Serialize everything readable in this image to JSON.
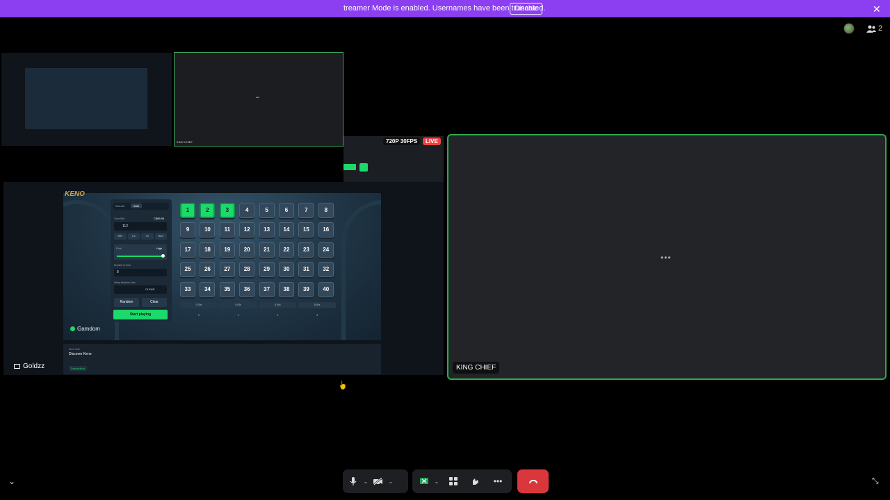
{
  "banner": {
    "text": "treamer Mode is enabled. Usernames have been truncated.",
    "disable_label": "Disable",
    "close_icon": "close-icon"
  },
  "top_right": {
    "people_count": "2"
  },
  "nested_share": {
    "title": "KING LIVES",
    "participant_name": "KING CHIEF"
  },
  "stream_badges": {
    "resolution": "720P 30FPS",
    "live": "LIVE"
  },
  "game": {
    "logo": "KENO",
    "tabs": [
      "Manual",
      "Auto"
    ],
    "your_bet_label": "Your Bet",
    "balance": "C$68.96",
    "bet_value": "112",
    "bet_chips": [
      "MIN",
      "1/2",
      "X2",
      "MAX"
    ],
    "risk_label": "Risk",
    "risk_value": "High",
    "number_of_games_label": "Number of bets",
    "number_of_games_value": "8",
    "delay_label": "Delay between bets",
    "delay_clear": "CLEAR",
    "random_label": "Random",
    "clear_label": "Clear",
    "start_label": "Start playing",
    "brand": "Gamdom",
    "numbers": [
      "1",
      "2",
      "3",
      "4",
      "5",
      "6",
      "7",
      "8",
      "9",
      "10",
      "11",
      "12",
      "13",
      "14",
      "15",
      "16",
      "17",
      "18",
      "19",
      "20",
      "21",
      "22",
      "23",
      "24",
      "25",
      "26",
      "27",
      "28",
      "29",
      "30",
      "31",
      "32",
      "33",
      "34",
      "35",
      "36",
      "37",
      "38",
      "39",
      "40"
    ],
    "selected": [
      1,
      2,
      3
    ],
    "payouts": [
      "0.00x",
      "0.00x",
      "0.00x",
      "8.50x"
    ],
    "hits": [
      "0",
      "1",
      "2",
      "3"
    ],
    "description_game_label": "Keno Hub",
    "description_title": "Discover Keno",
    "description_tab": "Description"
  },
  "share_user": "Goldzz",
  "participant": {
    "name": "KING CHIEF"
  },
  "colors": {
    "banner": "#8b3ff0",
    "accent_green": "#1bd96a",
    "speaking_border": "#2fa84f",
    "hangup": "#da373c"
  }
}
